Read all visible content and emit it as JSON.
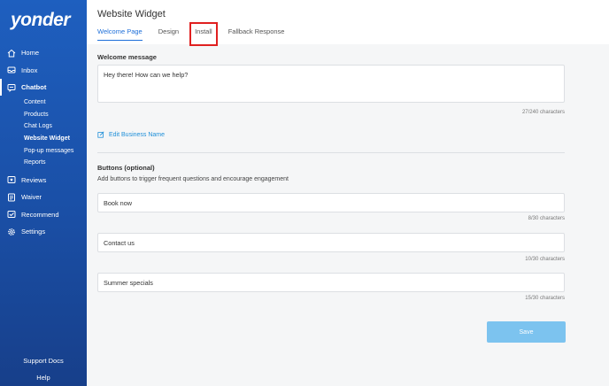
{
  "sidebar": {
    "logo": "yonder",
    "items": [
      {
        "label": "Home",
        "icon": "home-icon"
      },
      {
        "label": "Inbox",
        "icon": "inbox-icon"
      },
      {
        "label": "Chatbot",
        "icon": "chat-icon"
      },
      {
        "label": "Reviews",
        "icon": "star-icon"
      },
      {
        "label": "Waiver",
        "icon": "waiver-icon"
      },
      {
        "label": "Recommend",
        "icon": "recommend-icon"
      },
      {
        "label": "Settings",
        "icon": "gear-icon"
      }
    ],
    "chatbot_subitems": [
      "Content",
      "Products",
      "Chat Logs",
      "Website Widget",
      "Pop-up messages",
      "Reports"
    ],
    "footer": {
      "support": "Support Docs",
      "help": "Help"
    }
  },
  "header": {
    "title": "Website Widget",
    "tabs": [
      "Welcome Page",
      "Design",
      "Install",
      "Fallback Response"
    ]
  },
  "welcome": {
    "label": "Welcome message",
    "value": "Hey there! How can we help?",
    "counter": "27/240 characters"
  },
  "edit_link": "Edit Business Name",
  "buttons_section": {
    "label": "Buttons (optional)",
    "helper": "Add buttons to trigger frequent questions and encourage engagement",
    "fields": [
      {
        "value": "Book now",
        "counter": "8/30 characters"
      },
      {
        "value": "Contact us",
        "counter": "10/30 characters"
      },
      {
        "value": "Summer specials",
        "counter": "15/30 characters"
      }
    ]
  },
  "save_label": "Save",
  "colors": {
    "sidebar": "#1e5fbf",
    "accent": "#1e6fd9",
    "save": "#7cc3ef",
    "highlight": "#e02020"
  }
}
